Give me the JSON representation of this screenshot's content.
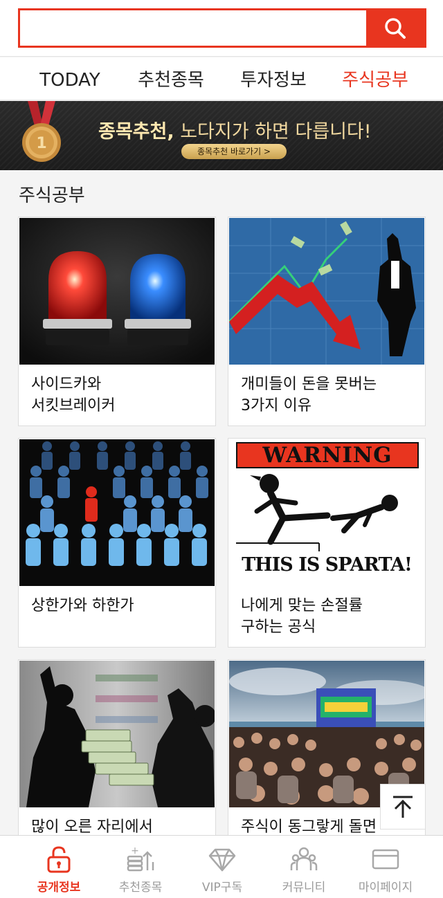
{
  "search": {
    "placeholder": "",
    "value": "",
    "icon": "search-icon"
  },
  "nav": {
    "tabs": [
      {
        "label": "TODAY",
        "active": false
      },
      {
        "label": "추천종목",
        "active": false
      },
      {
        "label": "투자정보",
        "active": false
      },
      {
        "label": "주식공부",
        "active": true
      }
    ]
  },
  "banner": {
    "headline_bold": "종목추천,",
    "headline_rest": " 노다지가 하면 다릅니다!",
    "cta": "종목추천 바로가기  >",
    "icon": "gold-medal-icon"
  },
  "section": {
    "title": "주식공부"
  },
  "articles": [
    {
      "title": "사이드카와\n서킷브레이커",
      "image": "siren-lights-image"
    },
    {
      "title": "개미들이 돈을 못버는\n3가지 이유",
      "image": "falling-stock-chart-image"
    },
    {
      "title": "상한가와 하한가",
      "image": "crowd-figures-image"
    },
    {
      "title": "나에게 맞는 손절률\n구하는 공식",
      "image": "warning-this-is-sparta-image",
      "image_text_top": "WARNING",
      "image_text_bottom": "THIS IS SPARTA!"
    },
    {
      "title": "많이 오른 자리에서",
      "image": "money-stack-silhouettes-image"
    },
    {
      "title": "주식이 동그랗게 돌면",
      "image": "beach-festival-crowd-image"
    }
  ],
  "bottom_nav": [
    {
      "label": "공개정보",
      "icon": "unlocked-padlock-icon",
      "active": true
    },
    {
      "label": "추천종목",
      "icon": "coin-stack-arrow-icon",
      "active": false
    },
    {
      "label": "VIP구독",
      "icon": "diamond-icon",
      "active": false
    },
    {
      "label": "커뮤니티",
      "icon": "people-group-icon",
      "active": false
    },
    {
      "label": "마이페이지",
      "icon": "card-icon",
      "active": false
    }
  ],
  "scroll_top": {
    "icon": "arrow-up-to-top-icon"
  },
  "colors": {
    "accent": "#e8351f",
    "inactive": "#9a9a9a",
    "banner_bg": "#222222",
    "banner_gold": "#f2d9a0"
  }
}
